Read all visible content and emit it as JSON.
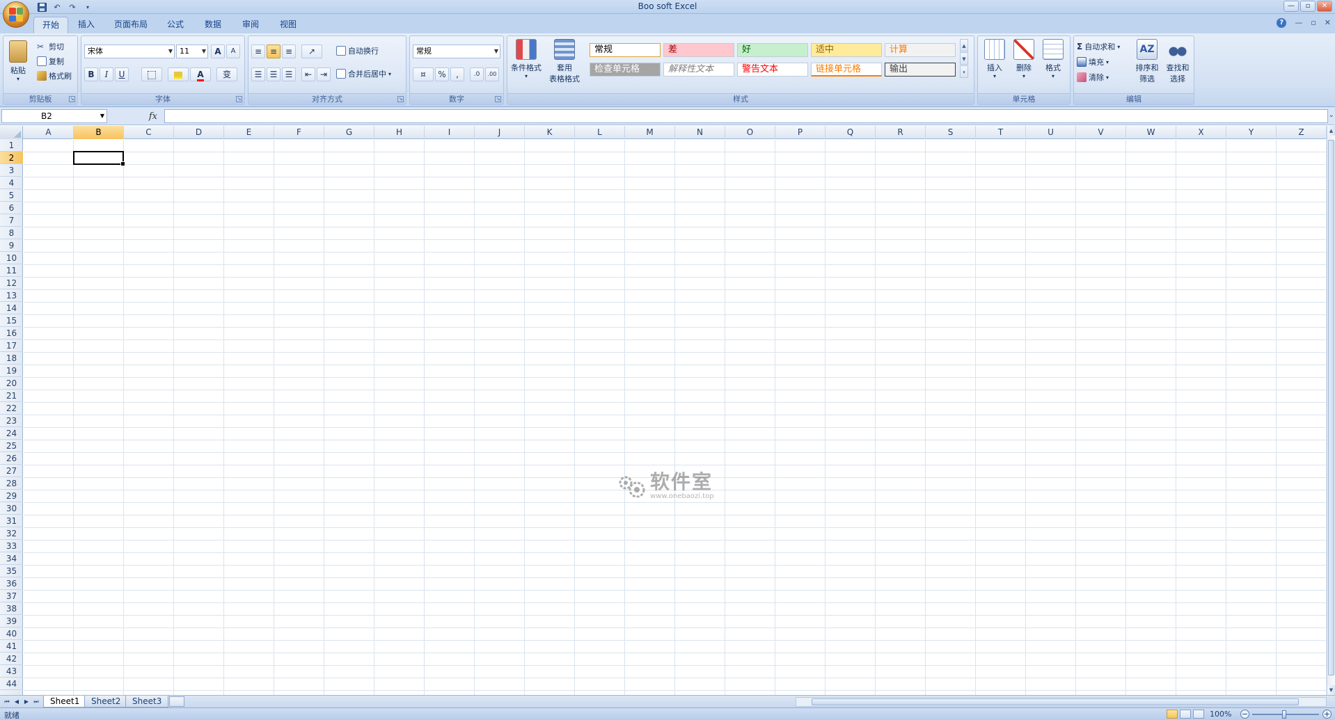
{
  "window": {
    "title": "Boo   soft Excel"
  },
  "ribbon_tabs": [
    {
      "label": "开始",
      "active": true
    },
    {
      "label": "插入"
    },
    {
      "label": "页面布局"
    },
    {
      "label": "公式"
    },
    {
      "label": "数据"
    },
    {
      "label": "审阅"
    },
    {
      "label": "视图"
    }
  ],
  "clipboard": {
    "paste": "粘贴",
    "cut": "剪切",
    "copy": "复制",
    "format_painter": "格式刷",
    "label": "剪贴板"
  },
  "font": {
    "name": "宋体",
    "size": "11",
    "grow": "A",
    "shrink": "A",
    "bold": "B",
    "italic": "I",
    "underline": "U",
    "font_color": "A",
    "phonetic": "变",
    "label": "字体"
  },
  "alignment": {
    "wrap_text": "自动换行",
    "merge_center": "合并后居中",
    "label": "对齐方式"
  },
  "number": {
    "format": "常规",
    "percent": "%",
    "comma": ",",
    "inc_decimal": ".0",
    "dec_decimal": ".00",
    "label": "数字"
  },
  "styles": {
    "conditional_format": "条件格式",
    "table_format_1": "套用",
    "table_format_2": "表格格式",
    "cells": [
      {
        "label": "常规",
        "bg": "#ffffff",
        "fg": "#000000",
        "border": "#e0a23a"
      },
      {
        "label": "差",
        "bg": "#ffc7ce",
        "fg": "#9c0006"
      },
      {
        "label": "好",
        "bg": "#c6efce",
        "fg": "#006100"
      },
      {
        "label": "适中",
        "bg": "#ffeb9c",
        "fg": "#9c6500"
      },
      {
        "label": "计算",
        "bg": "#f2f2f2",
        "fg": "#fa7d00"
      },
      {
        "label": "检查单元格",
        "bg": "#a5a5a5",
        "fg": "#ffffff"
      },
      {
        "label": "解释性文本",
        "bg": "#ffffff",
        "fg": "#7f7f7f"
      },
      {
        "label": "警告文本",
        "bg": "#ffffff",
        "fg": "#ff0000"
      },
      {
        "label": "链接单元格",
        "bg": "#ffffff",
        "fg": "#fa7d00"
      },
      {
        "label": "输出",
        "bg": "#f2f2f2",
        "fg": "#3f3f3f"
      }
    ],
    "label": "样式"
  },
  "cells_group": {
    "insert": "插入",
    "delete": "删除",
    "format": "格式",
    "label": "单元格"
  },
  "editing": {
    "autosum": "自动求和",
    "fill": "填充",
    "clear": "清除",
    "sort_filter_1": "排序和",
    "sort_filter_2": "筛选",
    "find_select_1": "查找和",
    "find_select_2": "选择",
    "label": "编辑"
  },
  "formula_bar": {
    "name_box": "B2",
    "fx": "fx",
    "value": ""
  },
  "grid": {
    "columns": [
      "A",
      "B",
      "C",
      "D",
      "E",
      "F",
      "G",
      "H",
      "I",
      "J",
      "K",
      "L",
      "M",
      "N",
      "O",
      "P",
      "Q",
      "R",
      "S",
      "T",
      "U",
      "V",
      "W",
      "X",
      "Y",
      "Z"
    ],
    "rows": [
      "1",
      "2",
      "3",
      "4",
      "5",
      "6",
      "7",
      "8",
      "9",
      "10",
      "11",
      "12",
      "13",
      "14",
      "15",
      "16",
      "17",
      "18",
      "19",
      "20",
      "21",
      "22",
      "23",
      "24",
      "25",
      "26",
      "27",
      "28",
      "29",
      "30",
      "31",
      "32",
      "33",
      "34",
      "35",
      "36",
      "37",
      "38",
      "39",
      "40",
      "41",
      "42",
      "43",
      "44"
    ],
    "selected_column": "B",
    "selected_row": "2"
  },
  "watermark": {
    "name": "软件室",
    "url": "www.onebaozi.top"
  },
  "sheets": [
    {
      "label": "Sheet1",
      "active": true
    },
    {
      "label": "Sheet2"
    },
    {
      "label": "Sheet3"
    }
  ],
  "status": {
    "ready": "就绪",
    "zoom": "100%"
  },
  "colors": {
    "accent": "#15428b",
    "selection": "#f7c25e"
  }
}
